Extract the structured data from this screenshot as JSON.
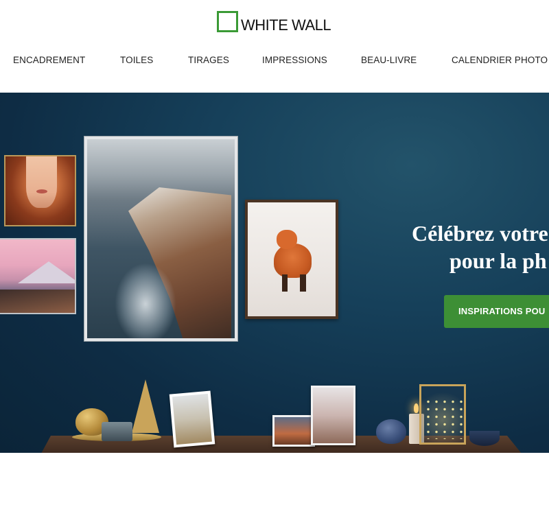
{
  "brand": {
    "name": "WHITE WALL",
    "accent": "#3a9a35"
  },
  "nav": {
    "items": [
      {
        "label": "ENCADREMENT"
      },
      {
        "label": "TOILES"
      },
      {
        "label": "TIRAGES"
      },
      {
        "label": "IMPRESSIONS"
      },
      {
        "label": "BEAU-LIVRE"
      },
      {
        "label": "CALENDRIER PHOTO"
      }
    ]
  },
  "hero": {
    "title_line1": "Célébrez votre",
    "title_line2": "pour la ph",
    "cta_label": "INSPIRATIONS POU",
    "cta_color": "#3d8f35",
    "background_color": "#16405a",
    "artworks": [
      {
        "subject": "red-haired woman portrait"
      },
      {
        "subject": "pink sunset mountain lake"
      },
      {
        "subject": "coastal cliffs and sea"
      },
      {
        "subject": "red fox in snow"
      }
    ]
  }
}
